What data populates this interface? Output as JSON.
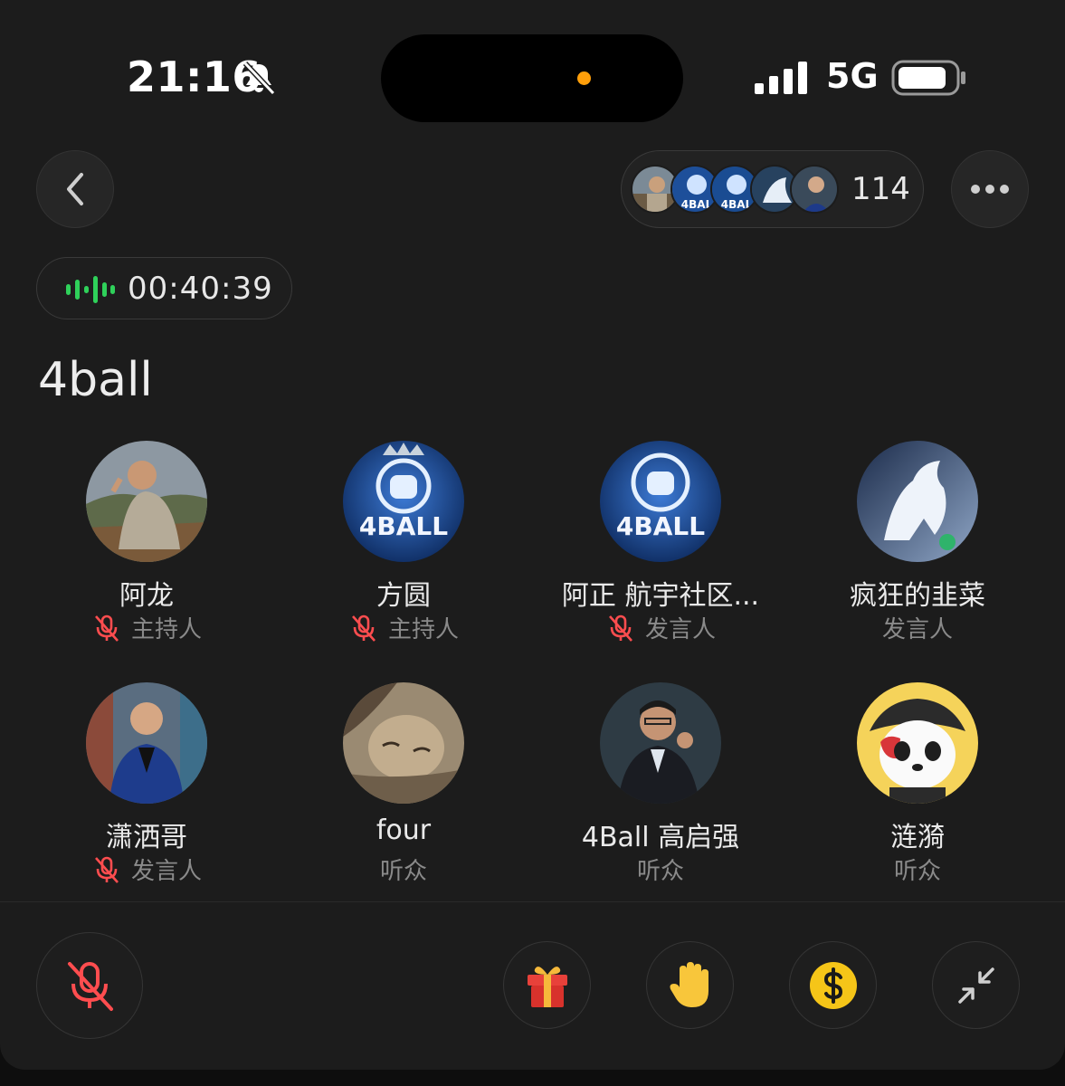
{
  "status_bar": {
    "time": "21:16",
    "network": "5G"
  },
  "header": {
    "listener_count": "114"
  },
  "timer": {
    "elapsed": "00:40:39"
  },
  "room": {
    "title": "4ball"
  },
  "participants": [
    {
      "name": "阿龙",
      "role": "主持人",
      "muted": true,
      "avatar": "photo-man-hiking"
    },
    {
      "name": "方圆",
      "role": "主持人",
      "muted": true,
      "avatar": "4ball-logo-crown"
    },
    {
      "name": "阿正 航宇社区...",
      "role": "发言人",
      "muted": true,
      "avatar": "4ball-logo"
    },
    {
      "name": "疯狂的韭菜",
      "role": "发言人",
      "muted": false,
      "avatar": "white-horse"
    },
    {
      "name": "潇洒哥",
      "role": "发言人",
      "muted": true,
      "avatar": "photo-man-blue-suit"
    },
    {
      "name": "four",
      "role": "听众",
      "muted": false,
      "avatar": "sleeping-face"
    },
    {
      "name": "4Ball 高启强",
      "role": "听众",
      "muted": false,
      "avatar": "man-on-phone"
    },
    {
      "name": "涟漪",
      "role": "听众",
      "muted": false,
      "avatar": "pirate-panda"
    }
  ],
  "bottom_bar": {
    "buttons": [
      "mic-muted-icon",
      "gift-icon",
      "raised-hand-icon",
      "dollar-coin-icon",
      "minimize-icon"
    ]
  },
  "colors": {
    "accent_green": "#2fd15a",
    "muted_red": "#ff4d4f",
    "background": "#1c1c1c"
  }
}
